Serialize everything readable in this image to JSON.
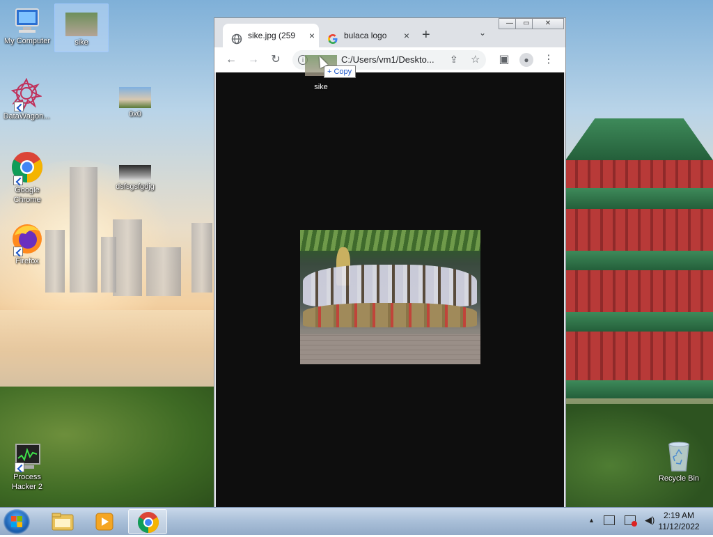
{
  "desktop": {
    "icons": [
      {
        "label": "My Computer"
      },
      {
        "label": "sike"
      },
      {
        "label": "DataWagon..."
      },
      {
        "label": "0x0"
      },
      {
        "label": "Google Chrome"
      },
      {
        "label": "dsfsgsfgdjg"
      },
      {
        "label": "Firefox"
      },
      {
        "label": "Process Hacker 2"
      },
      {
        "label": "Recycle Bin"
      }
    ]
  },
  "browser": {
    "tabs": [
      {
        "label": "sike.jpg (259",
        "close": "×"
      },
      {
        "label": "bulaca logo",
        "close": "×"
      }
    ],
    "new_tab": "+",
    "tab_list": "⌄",
    "caption": {
      "minimize": "—",
      "restore": "▭",
      "close": "✕"
    },
    "toolbar": {
      "back": "←",
      "forward": "→",
      "reload": "↻",
      "address": "C:/Users/vm1/Deskto...",
      "share": "⇪",
      "bookmark": "☆",
      "side_panel": "▣",
      "profile": "●",
      "menu": "⋮"
    }
  },
  "drag": {
    "label": "sike",
    "copy_tip": "+ Copy"
  },
  "taskbar": {
    "clock_time": "2:19 AM",
    "clock_date": "11/12/2022",
    "tray_arrow": "▲"
  }
}
